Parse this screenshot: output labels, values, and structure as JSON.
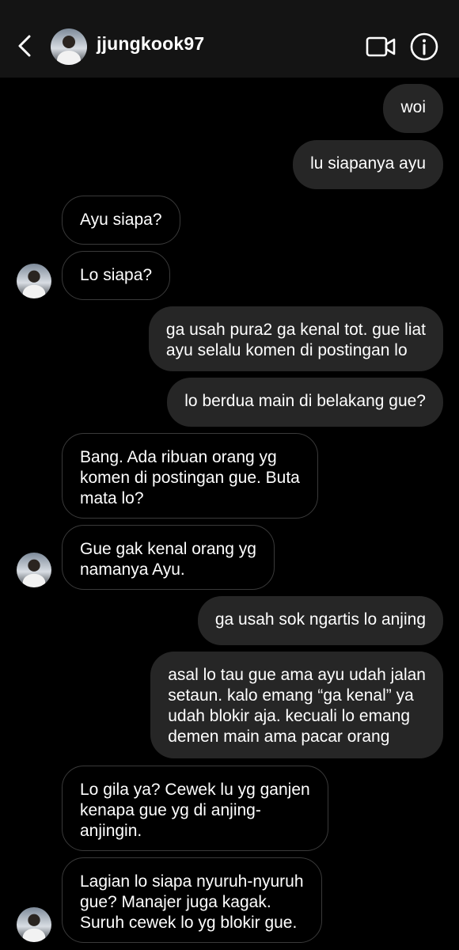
{
  "header": {
    "username": "jjungkook97",
    "back_icon": "chevron-left-icon",
    "video_icon": "video-camera-icon",
    "info_icon": "info-icon"
  },
  "messages": [
    {
      "from": "me",
      "text": "woi"
    },
    {
      "from": "me",
      "text": "lu siapanya ayu"
    },
    {
      "from": "them",
      "text": "Ayu siapa?"
    },
    {
      "from": "them",
      "text": "Lo siapa?"
    },
    {
      "from": "me",
      "text": "ga usah pura2 ga kenal tot. gue liat\nayu selalu komen di postingan lo"
    },
    {
      "from": "me",
      "text": "lo berdua main di belakang gue?"
    },
    {
      "from": "them",
      "text": "Bang. Ada ribuan orang yg\nkomen di postingan gue. Buta\nmata lo?"
    },
    {
      "from": "them",
      "text": "Gue gak kenal orang yg\nnamanya Ayu."
    },
    {
      "from": "me",
      "text": "ga usah sok ngartis lo anjing"
    },
    {
      "from": "me",
      "text": "asal lo tau gue ama ayu udah jalan\nsetaun. kalo emang “ga kenal” ya\nudah blokir aja. kecuali lo emang\ndemen main ama pacar orang"
    },
    {
      "from": "them",
      "text": "Lo gila ya? Cewek lu yg ganjen\nkenapa gue yg di anjing-\nanjingin."
    },
    {
      "from": "them",
      "text": "Lagian lo siapa nyuruh-nyuruh\ngue? Manajer juga kagak.\nSuruh cewek lo yg blokir gue."
    }
  ],
  "colors": {
    "background": "#000000",
    "header_bg": "#141414",
    "outgoing_bubble": "#262626",
    "incoming_border": "#3a3a3a",
    "text": "#ffffff"
  }
}
